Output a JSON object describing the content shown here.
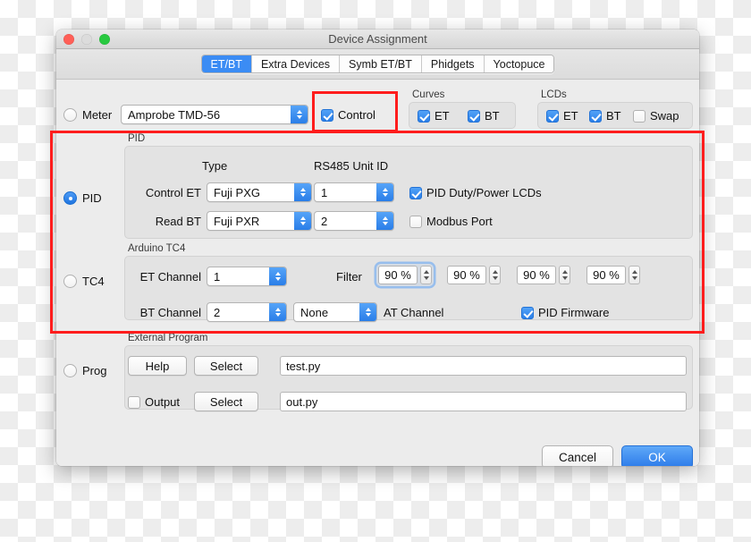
{
  "window": {
    "title": "Device Assignment",
    "traffic_lights": [
      "close-button",
      "minimize-button",
      "zoom-button"
    ]
  },
  "tabs": [
    {
      "label": "ET/BT",
      "active": true
    },
    {
      "label": "Extra Devices",
      "active": false
    },
    {
      "label": "Symb ET/BT",
      "active": false
    },
    {
      "label": "Phidgets",
      "active": false
    },
    {
      "label": "Yoctopuce",
      "active": false
    }
  ],
  "meter_row": {
    "radio_label": "Meter",
    "radio_selected": false,
    "device": "Amprobe TMD-56",
    "control": {
      "label": "Control",
      "checked": true
    },
    "curves": {
      "title": "Curves",
      "items": [
        {
          "label": "ET",
          "checked": true
        },
        {
          "label": "BT",
          "checked": true
        }
      ]
    },
    "lcds": {
      "title": "LCDs",
      "items": [
        {
          "label": "ET",
          "checked": true
        },
        {
          "label": "BT",
          "checked": true
        },
        {
          "label": "Swap",
          "checked": false
        }
      ]
    }
  },
  "pid": {
    "radio_label": "PID",
    "radio_selected": true,
    "group_title": "PID",
    "col_type": "Type",
    "col_unit": "RS485 Unit ID",
    "rows": [
      {
        "label": "Control ET",
        "type": "Fuji PXG",
        "unit": "1"
      },
      {
        "label": "Read BT",
        "type": "Fuji PXR",
        "unit": "2"
      }
    ],
    "options": [
      {
        "label": "PID Duty/Power LCDs",
        "checked": true
      },
      {
        "label": "Modbus Port",
        "checked": false
      }
    ]
  },
  "tc4": {
    "radio_label": "TC4",
    "radio_selected": false,
    "group_title": "Arduino TC4",
    "et_channel_label": "ET Channel",
    "et_channel": "1",
    "bt_channel_label": "BT Channel",
    "bt_channel": "2",
    "at_channel_value": "None",
    "at_channel_label": "AT Channel",
    "filter_label": "Filter",
    "filters": [
      "90 %",
      "90 %",
      "90 %",
      "90 %"
    ],
    "filter_focused_index": 0,
    "pid_firmware": {
      "label": "PID Firmware",
      "checked": true
    }
  },
  "prog": {
    "radio_label": "Prog",
    "radio_selected": false,
    "group_title": "External Program",
    "help_label": "Help",
    "select_label_1": "Select",
    "program_path": "test.py",
    "output_checkbox": {
      "label": "Output",
      "checked": false
    },
    "select_label_2": "Select",
    "output_path": "out.py"
  },
  "footer": {
    "cancel_label": "Cancel",
    "ok_label": "OK"
  },
  "annotations": {
    "control_highlight": "red-rectangle-around-control-checkbox",
    "pid_tc4_highlight": "red-rectangle-around-pid-and-tc4-sections"
  },
  "colors": {
    "accent_blue": "#2a7ee8",
    "annotation_red": "#ff1d1d",
    "window_bg": "#ececec",
    "group_bg": "#e3e3e3"
  }
}
